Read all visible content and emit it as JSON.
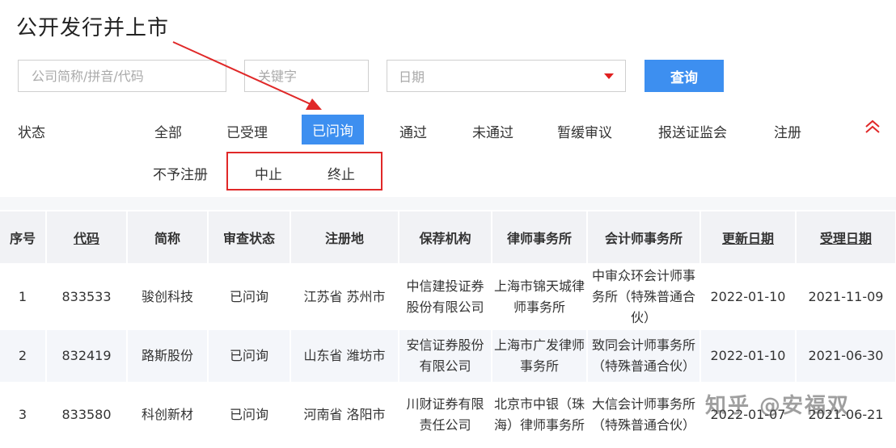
{
  "page_title": "公开发行并上市",
  "search": {
    "company_placeholder": "公司简称/拼音/代码",
    "keyword_placeholder": "关键字",
    "date_placeholder": "日期",
    "query_label": "查询"
  },
  "status": {
    "label": "状态",
    "filters": [
      "全部",
      "已受理",
      "已问询",
      "通过",
      "未通过",
      "暂缓审议",
      "报送证监会",
      "注册",
      "不予注册",
      "中止",
      "终止"
    ],
    "active": "已问询"
  },
  "table": {
    "headers": [
      "序号",
      "代码",
      "简称",
      "审查状态",
      "注册地",
      "保荐机构",
      "律师事务所",
      "会计师事务所",
      "更新日期",
      "受理日期"
    ],
    "rows": [
      {
        "index": "1",
        "code": "833533",
        "name": "骏创科技",
        "status": "已问询",
        "location": "江苏省 苏州市",
        "sponsor": "中信建投证券股份有限公司",
        "law_firm": "上海市锦天城律师事务所",
        "accounting_firm": "中审众环会计师事务所（特殊普通合伙）",
        "updated": "2022-01-10",
        "accepted": "2021-11-09"
      },
      {
        "index": "2",
        "code": "832419",
        "name": "路斯股份",
        "status": "已问询",
        "location": "山东省 潍坊市",
        "sponsor": "安信证券股份有限公司",
        "law_firm": "上海市广发律师事务所",
        "accounting_firm": "致同会计师事务所（特殊普通合伙）",
        "updated": "2022-01-10",
        "accepted": "2021-06-30"
      },
      {
        "index": "3",
        "code": "833580",
        "name": "科创新材",
        "status": "已问询",
        "location": "河南省 洛阳市",
        "sponsor": "川财证券有限责任公司",
        "law_firm": "北京市中银（珠海）律师事务所",
        "accounting_firm": "大信会计师事务所（特殊普通合伙）",
        "updated": "2022-01-07",
        "accepted": "2021-06-21"
      }
    ]
  },
  "watermark": "知乎 @安福双",
  "colors": {
    "accent": "#3d8ff0",
    "link": "#3a7fd6",
    "annotation_red": "#e02828"
  }
}
